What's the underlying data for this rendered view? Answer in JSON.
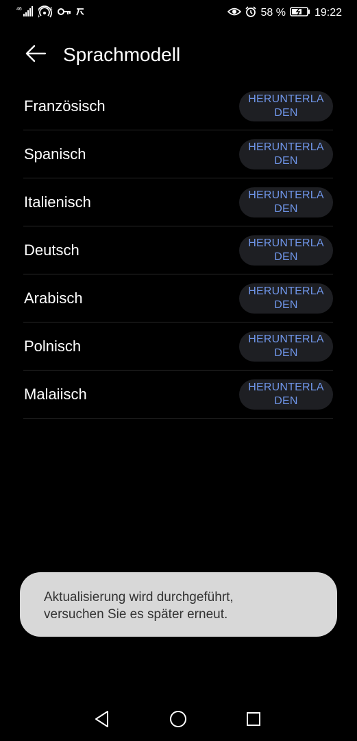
{
  "status_bar": {
    "network": "4G",
    "signal_text": "46",
    "battery": "58 %",
    "time": "19:22",
    "icons": [
      "signal-icon",
      "wifi-hotspot-icon",
      "key-icon",
      "nfc-icon",
      "eye-icon",
      "alarm-icon",
      "battery-icon"
    ]
  },
  "header": {
    "title": "Sprachmodell",
    "back_icon": "arrow-left-icon"
  },
  "languages": [
    {
      "name": "Französisch",
      "button": "HERUNTERLADEN"
    },
    {
      "name": "Spanisch",
      "button": "HERUNTERLADEN"
    },
    {
      "name": "Italienisch",
      "button": "HERUNTERLADEN"
    },
    {
      "name": "Deutsch",
      "button": "HERUNTERLADEN"
    },
    {
      "name": "Arabisch",
      "button": "HERUNTERLADEN"
    },
    {
      "name": "Polnisch",
      "button": "HERUNTERLADEN"
    },
    {
      "name": "Malaiisch",
      "button": "HERUNTERLADEN"
    }
  ],
  "toast": {
    "line1": "Aktualisierung wird durchgeführt,",
    "line2": "versuchen Sie es später erneut."
  },
  "nav_bar": {
    "back": "triangle-back-icon",
    "home": "circle-home-icon",
    "recents": "square-recents-icon"
  },
  "colors": {
    "background": "#000000",
    "button_bg": "#1e1f23",
    "button_text": "#6f95e8",
    "toast_bg": "#d8d8d8",
    "divider": "#2a2a2a"
  }
}
